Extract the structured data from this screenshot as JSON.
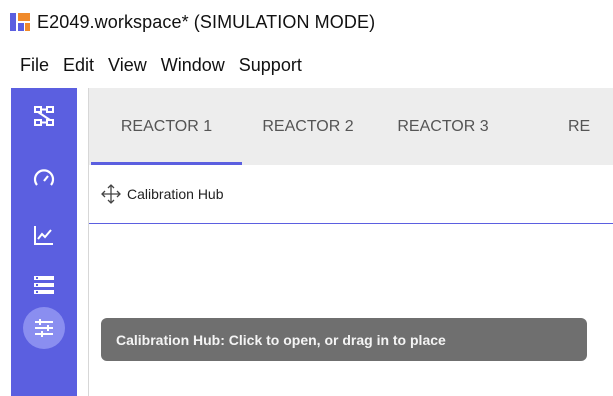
{
  "window": {
    "title": "E2049.workspace* (SIMULATION MODE)"
  },
  "menu": {
    "items": [
      "File",
      "Edit",
      "View",
      "Window",
      "Support"
    ]
  },
  "sidebar": {
    "icons": [
      "topology-icon",
      "gauge-icon",
      "line-chart-icon",
      "list-icon",
      "calibration-sliders-icon"
    ],
    "active": "calibration-sliders-icon"
  },
  "tabs": {
    "items": [
      "REACTOR 1",
      "REACTOR 2",
      "REACTOR 3",
      "RE"
    ],
    "active_index": 0
  },
  "panel": {
    "title": "Calibration Hub"
  },
  "tooltip": {
    "text": "Calibration Hub: Click to open, or drag in to place"
  },
  "colors": {
    "accent": "#5b5fe0",
    "accent_light": "#8a8ef0",
    "tab_bar": "#ededed",
    "tooltip_bg": "#6f6f6f"
  }
}
